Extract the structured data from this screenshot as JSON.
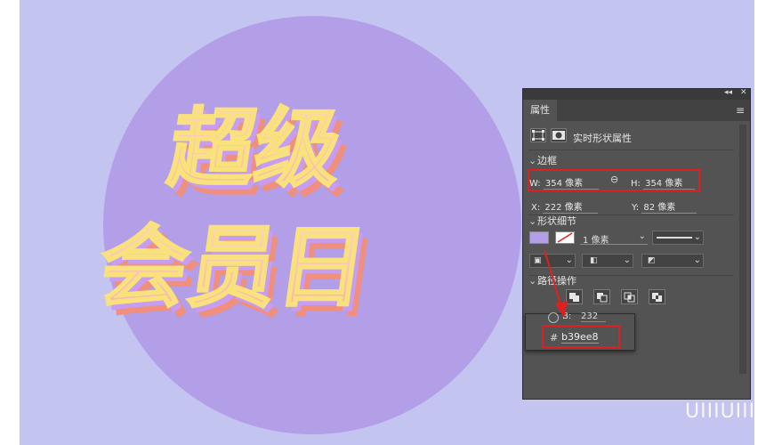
{
  "canvas": {
    "background": "#c3c4ef",
    "circle_color": "#b39ee8",
    "art_line1": "超级",
    "art_line2": "会员日",
    "text_fill": "#f7c6b7",
    "text_outline": "#f9e27b",
    "text_shadow_purple": "#c79cf3",
    "text_side": "#ef8f7c"
  },
  "panel": {
    "collapse_glyph": "◂◂",
    "close_glyph": "✕",
    "tab_label": "属性",
    "menu_glyph": "≡",
    "subtitle": "实时形状属性",
    "bounds": {
      "header": "边框",
      "w_label": "W:",
      "w_value": "354 像素",
      "h_label": "H:",
      "h_value": "354 像素",
      "x_label": "X:",
      "x_value": "222 像素",
      "y_label": "Y:",
      "y_value": "82 像素"
    },
    "shape": {
      "header": "形状细节",
      "fill_color": "#b39ee8",
      "stroke_width": "1 像素"
    },
    "path": {
      "header": "路径操作"
    }
  },
  "popup": {
    "b_label": "B:",
    "b_value": "232",
    "hash": "#",
    "hex_value": "b39ee8"
  },
  "highlight_color": "#e02020",
  "watermark": "UIIIUIII"
}
